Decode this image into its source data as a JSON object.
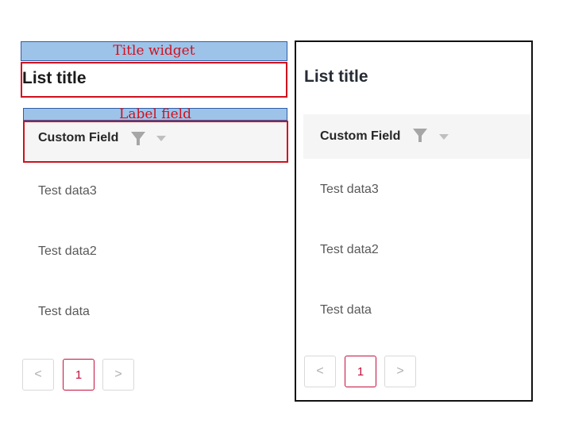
{
  "annotations": {
    "title_widget": "Title widget",
    "label_field": "Label field"
  },
  "list": {
    "title": "List title",
    "column_header": "Custom Field",
    "rows": [
      "Test data3",
      "Test data2",
      "Test data"
    ]
  },
  "pagination": {
    "prev_label": "<",
    "current_page": "1",
    "next_label": ">"
  },
  "icons": {
    "filter": "filter-icon",
    "sort": "caret-down-icon",
    "prev": "chevron-left-icon",
    "next": "chevron-right-icon"
  },
  "colors": {
    "annotation_fill": "#9ec3e8",
    "annotation_border": "#2f5ea8",
    "annotation_text": "#d0101e",
    "highlight_border": "#d0101e",
    "active_page": "#c4103e",
    "header_bg": "#f5f5f5"
  }
}
